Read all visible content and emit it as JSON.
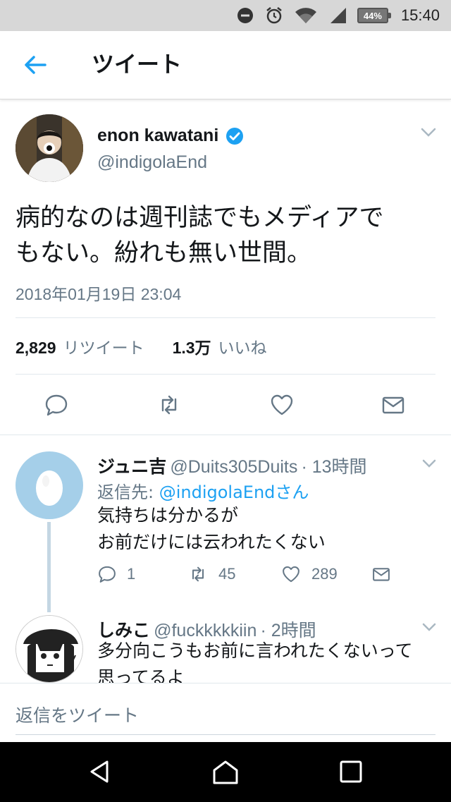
{
  "status_bar": {
    "battery": "44%",
    "time": "15:40",
    "icons": [
      "do-not-disturb-icon",
      "alarm-icon",
      "wifi-icon",
      "signal-icon",
      "battery-icon"
    ]
  },
  "header": {
    "back_icon": "back-arrow-icon",
    "title": "ツイート"
  },
  "tweet": {
    "display_name": "enon kawatani",
    "handle": "@indigolaEnd",
    "text_line1": "病的なのは週刊誌でもメディアで",
    "text_line2": "もない。紛れも無い世間。",
    "date": "2018年01月19日 23:04",
    "retweets_count": "2,829",
    "retweets_label": "リツイート",
    "likes_count": "1.3万",
    "likes_label": "いいね",
    "actions": [
      "reply-icon",
      "retweet-icon",
      "like-icon",
      "message-icon"
    ]
  },
  "replies": [
    {
      "name": "ジュニ吉",
      "handle": "@Duits305Duits",
      "time": "· 13時間",
      "reply_to_label": "返信先:",
      "reply_to_link": "@indigolaEndさん",
      "text_line1": "気持ちは分かるが",
      "text_line2": "お前だけには云われたくない",
      "reply_count": "1",
      "retweet_count": "45",
      "like_count": "289"
    },
    {
      "name": "しみこ",
      "handle": "@fuckkkkkiin",
      "time": "· 2時間",
      "text_line1": "多分向こうもお前に言われたくないって",
      "text_line2": "思ってるよ"
    }
  ],
  "compose": {
    "placeholder": "返信をツイート"
  },
  "nav_bar": {
    "buttons": [
      "back-triangle-icon",
      "home-icon",
      "recents-icon"
    ]
  },
  "colors": {
    "accent": "#1da1f2",
    "secondary_text": "#657786",
    "verified": "#1da1f2",
    "status_bar": "#d7d7d7",
    "nav_bar": "#000000"
  }
}
